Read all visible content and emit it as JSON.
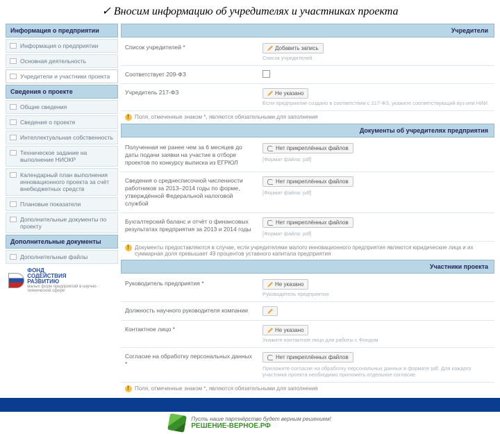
{
  "title_check": "✓",
  "title": "Вносим информацию об учредителях и участниках проекта",
  "sidebar": {
    "s1_header": "Информация о предприятии",
    "s1": [
      "Информация о предприятии",
      "Основная деятельность",
      "Учредители и участники проекта"
    ],
    "s2_header": "Сведения о проекте",
    "s2": [
      "Общие сведения",
      "Сведения о проекте",
      "Интеллектуальная собственность",
      "Техническое задание на выполнение НИОКР",
      "Календарный план выполнения инновационного проекта за счёт внебюджетных средств",
      "Плановые показатели",
      "Дополнительные документы по проекту"
    ],
    "s3_header": "Дополнительные документы",
    "s3": [
      "Дополнительные файлы"
    ]
  },
  "panels": {
    "p1_title": "Учредители",
    "r1_label": "Список учредителей *",
    "r1_btn": "Добавить запись",
    "r1_hint": "Список учредителей",
    "r2_label": "Соответствует 209-ФЗ",
    "r3_label": "Учредитель 217-ФЗ",
    "r3_val": "Не указано",
    "r3_hint": "Если предприятие создано в соответствии с 217-ФЗ, укажите соответствующий вуз или НИИ",
    "note1": "Поля, отмеченные знаком *, являются обязательными для заполнения",
    "p2_title": "Документы об учредителях предприятия",
    "r4_label": "Полученная не ранее чем за 6 месяцев до даты подачи заявки на участие в отборе проектов по конкурсу выписка из ЕГРЮЛ",
    "r4_val": "Нет прикреплённых файлов",
    "r4_hint": "[Формат файла: pdf]",
    "r5_label": "Сведения о среднесписочной численности работников за 2013–2014 годы по форме, утверждённой Федеральной налоговой службой",
    "r5_val": "Нет прикреплённых файлов",
    "r5_hint": "[Формат файла: pdf]",
    "r6_label": "Бухгалтерский баланс и отчёт о финансовых результатах предприятия за 2013 и 2014 годы",
    "r6_val": "Нет прикреплённых файлов",
    "r6_hint": "[Формат файла: pdf]",
    "note2": "Документы предоставляются в случае, если учредителями малого инновационного предприятия являются юридические лица и их суммарная доля превышает 49 процентов уставного капитала предприятия",
    "p3_title": "Участники проекта",
    "r7_label": "Руководитель предприятия *",
    "r7_val": "Не указано",
    "r7_hint": "Руководитель предприятия",
    "r8_label": "Должность научного руководителя компании",
    "r9_label": "Контактное лицо *",
    "r9_val": "Не указано",
    "r9_hint": "Укажите контактное лицо для работы с Фондом",
    "r10_label": "Согласие на обработку персональных данных *",
    "r10_val": "Нет прикреплённых файлов",
    "r10_hint": "Приложите согласие на обработку персональных данных в формате pdf. Для каждого участника проекта необходимо приложить отдельное согласие",
    "note3": "Поля, отмеченные знаком *, являются обязательными для заполнения"
  },
  "fund": {
    "l1": "ФОНД",
    "l2": "СОДЕЙСТВИЯ",
    "l3": "РАЗВИТИЮ",
    "l4": "малых форм предприятий в научно-технической сфере"
  },
  "footer": {
    "motto": "Пусть наше партнёрство будет верным решением!",
    "brand": "РЕШЕНИЕ-ВЕРНОЕ.РФ"
  }
}
